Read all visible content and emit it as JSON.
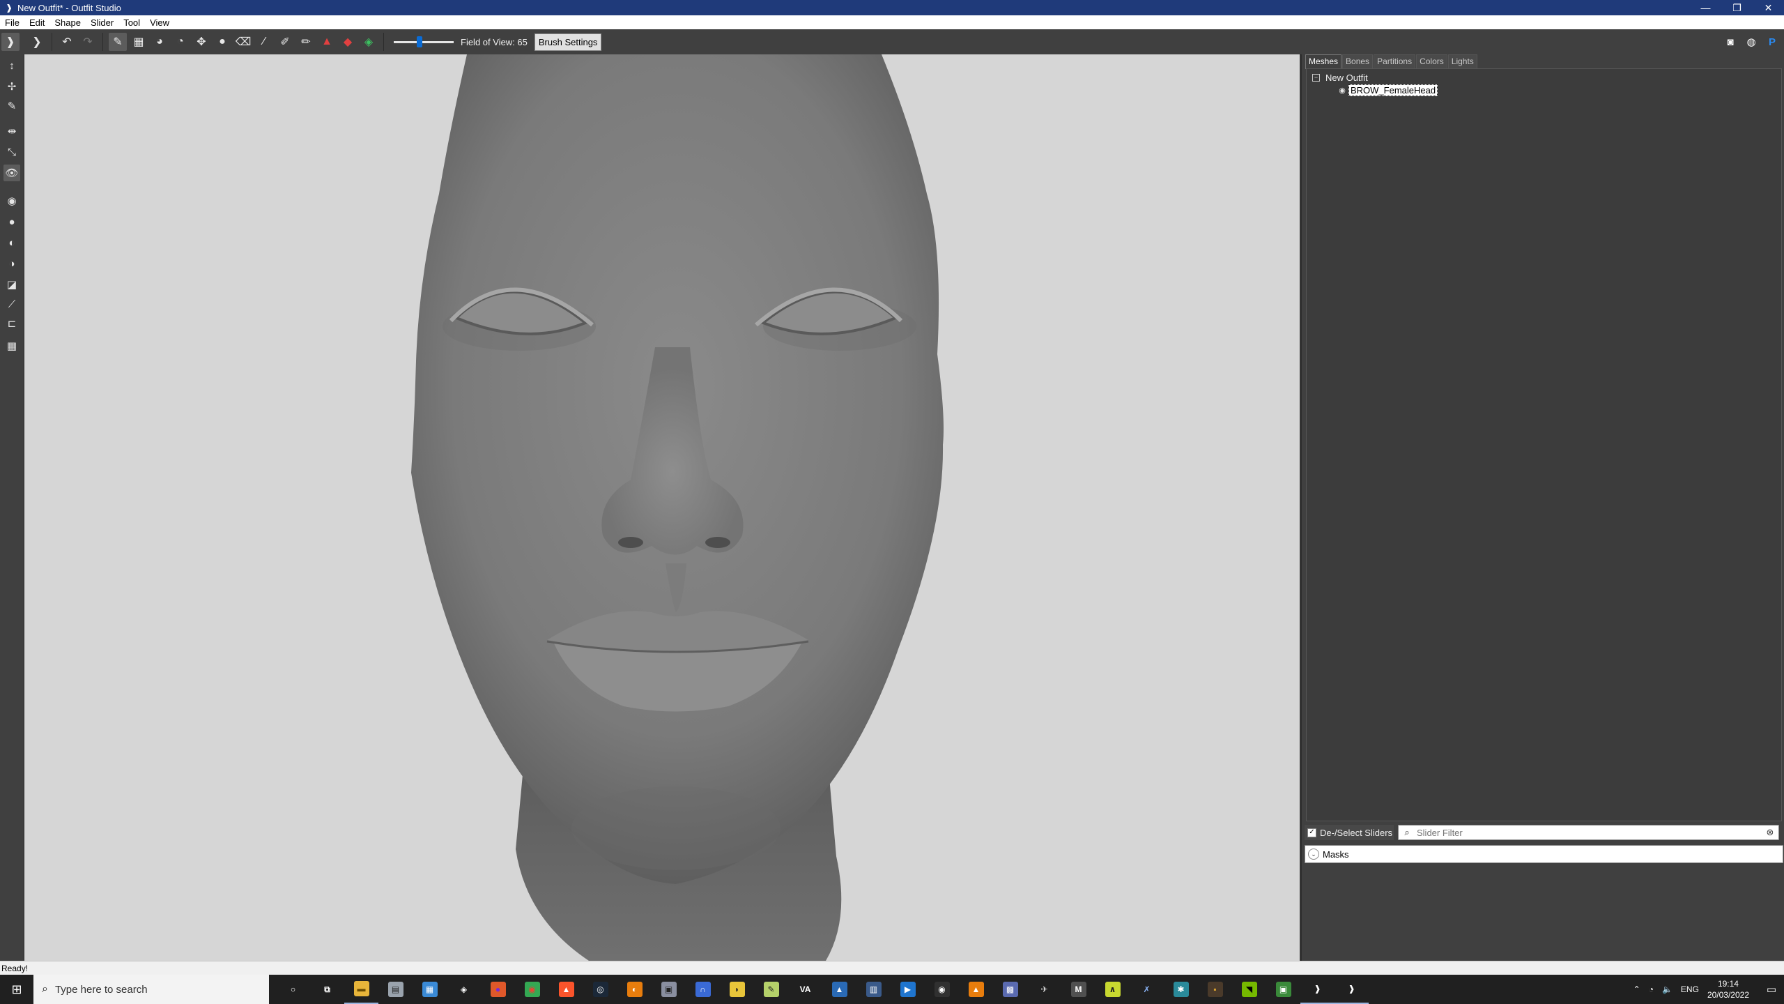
{
  "window": {
    "title": "New Outfit* - Outfit Studio",
    "minimize": "—",
    "restore": "❐",
    "close": "✕"
  },
  "menu": [
    "File",
    "Edit",
    "Shape",
    "Slider",
    "Tool",
    "View"
  ],
  "toolbar": {
    "field_of_view_label": "Field of View: 65",
    "field_of_view_value": 65,
    "brush_settings_label": "Brush Settings",
    "icons": [
      "select-mode-icon",
      "transform-mode-icon",
      "undo-icon",
      "redo-icon",
      "brush-icon",
      "mask-brush-icon",
      "inflate-brush-icon",
      "deflate-brush-icon",
      "move-brush-icon",
      "smooth-brush-icon",
      "undiff-brush-icon",
      "weight-brush-icon",
      "color-brush-icon",
      "alpha-brush-icon",
      "collapse-vertex-icon",
      "flip-edge-icon",
      "split-edge-icon"
    ],
    "right_icons": [
      "discord-icon",
      "github-icon",
      "paypal-icon"
    ]
  },
  "left_tools": [
    "transform-tool-icon",
    "pivot-tool-icon",
    "vertex-select-icon",
    "symmetry-x-icon",
    "edge-tool-icon",
    "visibility-toggle-icon",
    "point-mode-icon",
    "solid-mode-icon",
    "wire-mode-icon",
    "texture-mode-icon",
    "lighting-icon",
    "bones-view-icon",
    "floor-icon",
    "grid-icon"
  ],
  "panel": {
    "tabs": [
      "Meshes",
      "Bones",
      "Partitions",
      "Colors",
      "Lights"
    ],
    "active_tab": "Meshes",
    "tree_root": "New Outfit",
    "tree_child": "BROW_FemaleHead",
    "deselect_label": "De-/Select Sliders",
    "deselect_checked": true,
    "slider_filter_placeholder": "Slider Filter",
    "masks_label": "Masks"
  },
  "status": {
    "text": "Ready!"
  },
  "taskbar": {
    "search_placeholder": "Type here to search",
    "apps": [
      {
        "name": "cortana-icon",
        "glyph": "○",
        "color": "#202020",
        "fg": "#fff"
      },
      {
        "name": "task-view-icon",
        "glyph": "⧉",
        "color": "#202020",
        "fg": "#fff"
      },
      {
        "name": "file-explorer-icon",
        "glyph": "▬",
        "color": "#e8b53a",
        "fg": "#6b4c00"
      },
      {
        "name": "app-icon-2",
        "glyph": "▤",
        "color": "#9aa3ad",
        "fg": "#222"
      },
      {
        "name": "app-icon-3",
        "glyph": "▦",
        "color": "#3a8ad6",
        "fg": "#fff"
      },
      {
        "name": "defender-icon",
        "glyph": "◈",
        "color": "#202020",
        "fg": "#fff"
      },
      {
        "name": "firefox-icon",
        "glyph": "●",
        "color": "#e0582a",
        "fg": "#7a2ad6"
      },
      {
        "name": "chrome-icon",
        "glyph": "◉",
        "color": "#34a853",
        "fg": "#ea4335"
      },
      {
        "name": "brave-icon",
        "glyph": "▲",
        "color": "#fb542b",
        "fg": "#fff"
      },
      {
        "name": "steam-icon",
        "glyph": "◎",
        "color": "#1b2838",
        "fg": "#fff"
      },
      {
        "name": "blender-icon",
        "glyph": "◐",
        "color": "#e87d0d",
        "fg": "#fff"
      },
      {
        "name": "app-icon-11",
        "glyph": "▣",
        "color": "#8a8fa0",
        "fg": "#222"
      },
      {
        "name": "headphones-icon",
        "glyph": "∩",
        "color": "#3a6ad6",
        "fg": "#fff"
      },
      {
        "name": "app-icon-13",
        "glyph": "◗",
        "color": "#e8c53a",
        "fg": "#222"
      },
      {
        "name": "notepadpp-icon",
        "glyph": "✎",
        "color": "#b5d16a",
        "fg": "#222"
      },
      {
        "name": "va-icon",
        "glyph": "VA",
        "color": "#202020",
        "fg": "#fff"
      },
      {
        "name": "photos-icon",
        "glyph": "▲",
        "color": "#2a6ab5",
        "fg": "#fff"
      },
      {
        "name": "app-icon-17",
        "glyph": "▥",
        "color": "#3a5a8a",
        "fg": "#fff"
      },
      {
        "name": "media-player-icon",
        "glyph": "▶",
        "color": "#1f75cf",
        "fg": "#fff"
      },
      {
        "name": "obs-icon",
        "glyph": "◉",
        "color": "#303030",
        "fg": "#fff"
      },
      {
        "name": "vlc-icon",
        "glyph": "▲",
        "color": "#e87d0d",
        "fg": "#fff"
      },
      {
        "name": "app-icon-21",
        "glyph": "▩",
        "color": "#5a6ab0",
        "fg": "#fff"
      },
      {
        "name": "app-icon-22",
        "glyph": "✈",
        "color": "#202020",
        "fg": "#ddd"
      },
      {
        "name": "mo2-icon",
        "glyph": "M",
        "color": "#505050",
        "fg": "#fff"
      },
      {
        "name": "app-icon-24",
        "glyph": "∧",
        "color": "#c8d830",
        "fg": "#222"
      },
      {
        "name": "xedit-icon",
        "glyph": "✗",
        "color": "#202020",
        "fg": "#8ab4f8"
      },
      {
        "name": "app-icon-26",
        "glyph": "✱",
        "color": "#2a8a9a",
        "fg": "#fff"
      },
      {
        "name": "app-icon-27",
        "glyph": "▪",
        "color": "#4a3a2a",
        "fg": "#d6a030"
      },
      {
        "name": "nvidia-icon",
        "glyph": "◥",
        "color": "#76b900",
        "fg": "#000"
      },
      {
        "name": "app-icon-29",
        "glyph": "▣",
        "color": "#3a8a3a",
        "fg": "#fff"
      },
      {
        "name": "outfit-studio-icon-1",
        "glyph": "❱",
        "color": "#202020",
        "fg": "#fff"
      },
      {
        "name": "outfit-studio-icon-2",
        "glyph": "❱",
        "color": "#202020",
        "fg": "#fff"
      }
    ],
    "tray_lang": "ENG",
    "time": "19:14",
    "date": "20/03/2022"
  }
}
